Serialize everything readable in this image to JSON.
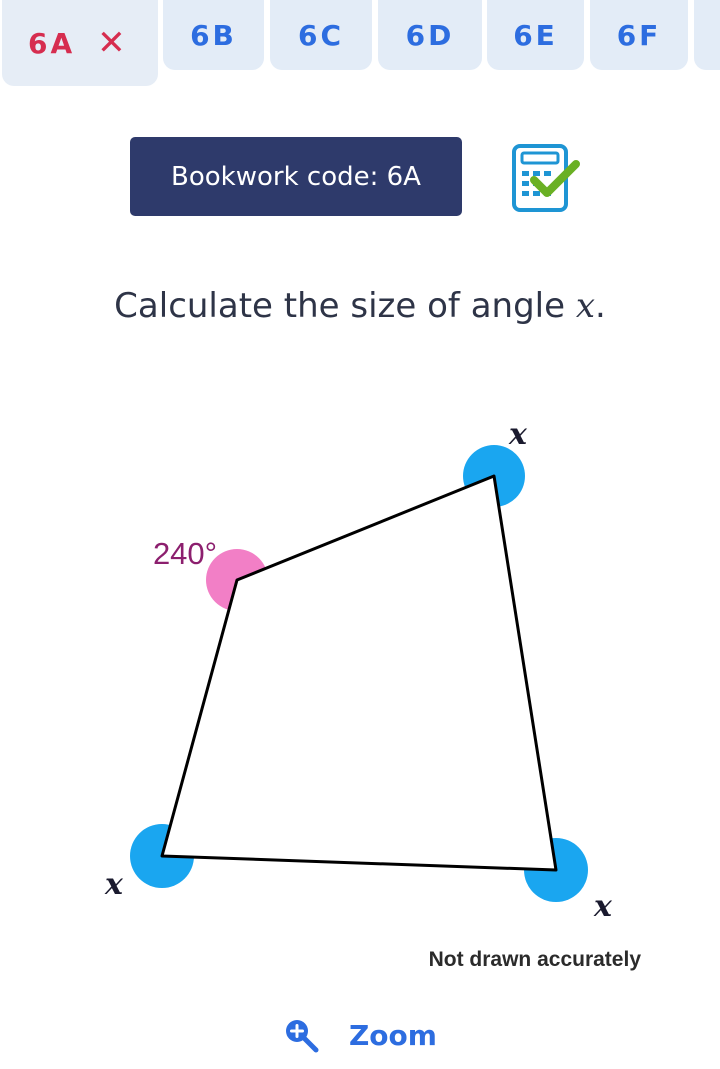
{
  "tabs": [
    {
      "label": "6A",
      "active": true
    },
    {
      "label": "6B"
    },
    {
      "label": "6C"
    },
    {
      "label": "6D"
    },
    {
      "label": "6E"
    },
    {
      "label": "6F"
    }
  ],
  "tab_close_icon": "close-icon",
  "bookwork": {
    "label": "Bookwork code: 6A"
  },
  "calculator_icon": "calculator-allowed-icon",
  "question": {
    "text": "Calculate the size of angle ",
    "variable": "x",
    "end": "."
  },
  "diagram": {
    "angle_labels": {
      "top_right": "x",
      "top_left": "240°",
      "bottom_left": "x",
      "bottom_right": "x"
    },
    "note": "Not drawn accurately",
    "colors": {
      "given_angle": "#f27fc6",
      "unknown_angle": "#1aa6f0",
      "label_given": "#8c1f6e",
      "label_unknown": "#1a1a2e"
    }
  },
  "zoom": {
    "label": "Zoom",
    "icon": "zoom-in-icon"
  }
}
